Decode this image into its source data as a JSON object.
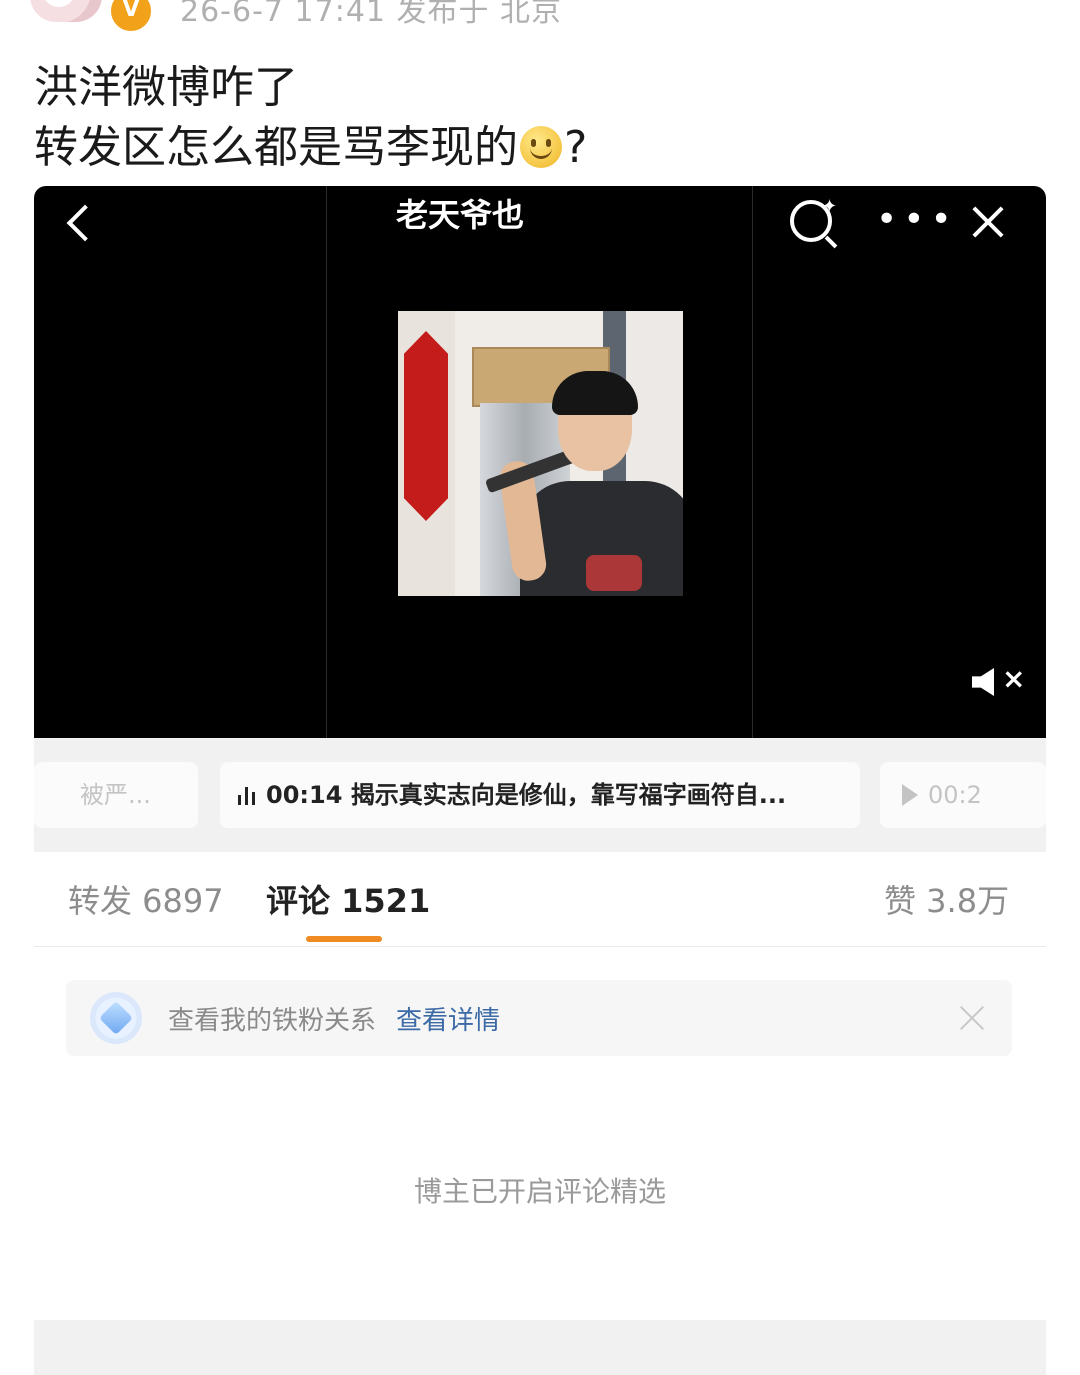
{
  "header": {
    "meta": "26-6-7 17:41  发布于 北京",
    "verified_badge": "V"
  },
  "post": {
    "line1": "洪洋微博咋了",
    "line2": "转发区怎么都是骂李现的",
    "line2_suffix": "?"
  },
  "video": {
    "caption": "老天爷也",
    "icons": [
      "back-icon",
      "search-icon",
      "more-icon",
      "close-icon",
      "mute-icon"
    ]
  },
  "chapters": {
    "left": "被严...",
    "main": "00:14 揭示真实志向是修仙，靠写福字画符自...",
    "right": "00:2"
  },
  "tabs": {
    "repost": "转发 6897",
    "comment": "评论 1521",
    "like": "赞 3.8万",
    "active_color": "#f08a22"
  },
  "fan_banner": {
    "text": "查看我的铁粉关系",
    "link": "查看详情"
  },
  "comments_note": "博主已开启评论精选"
}
